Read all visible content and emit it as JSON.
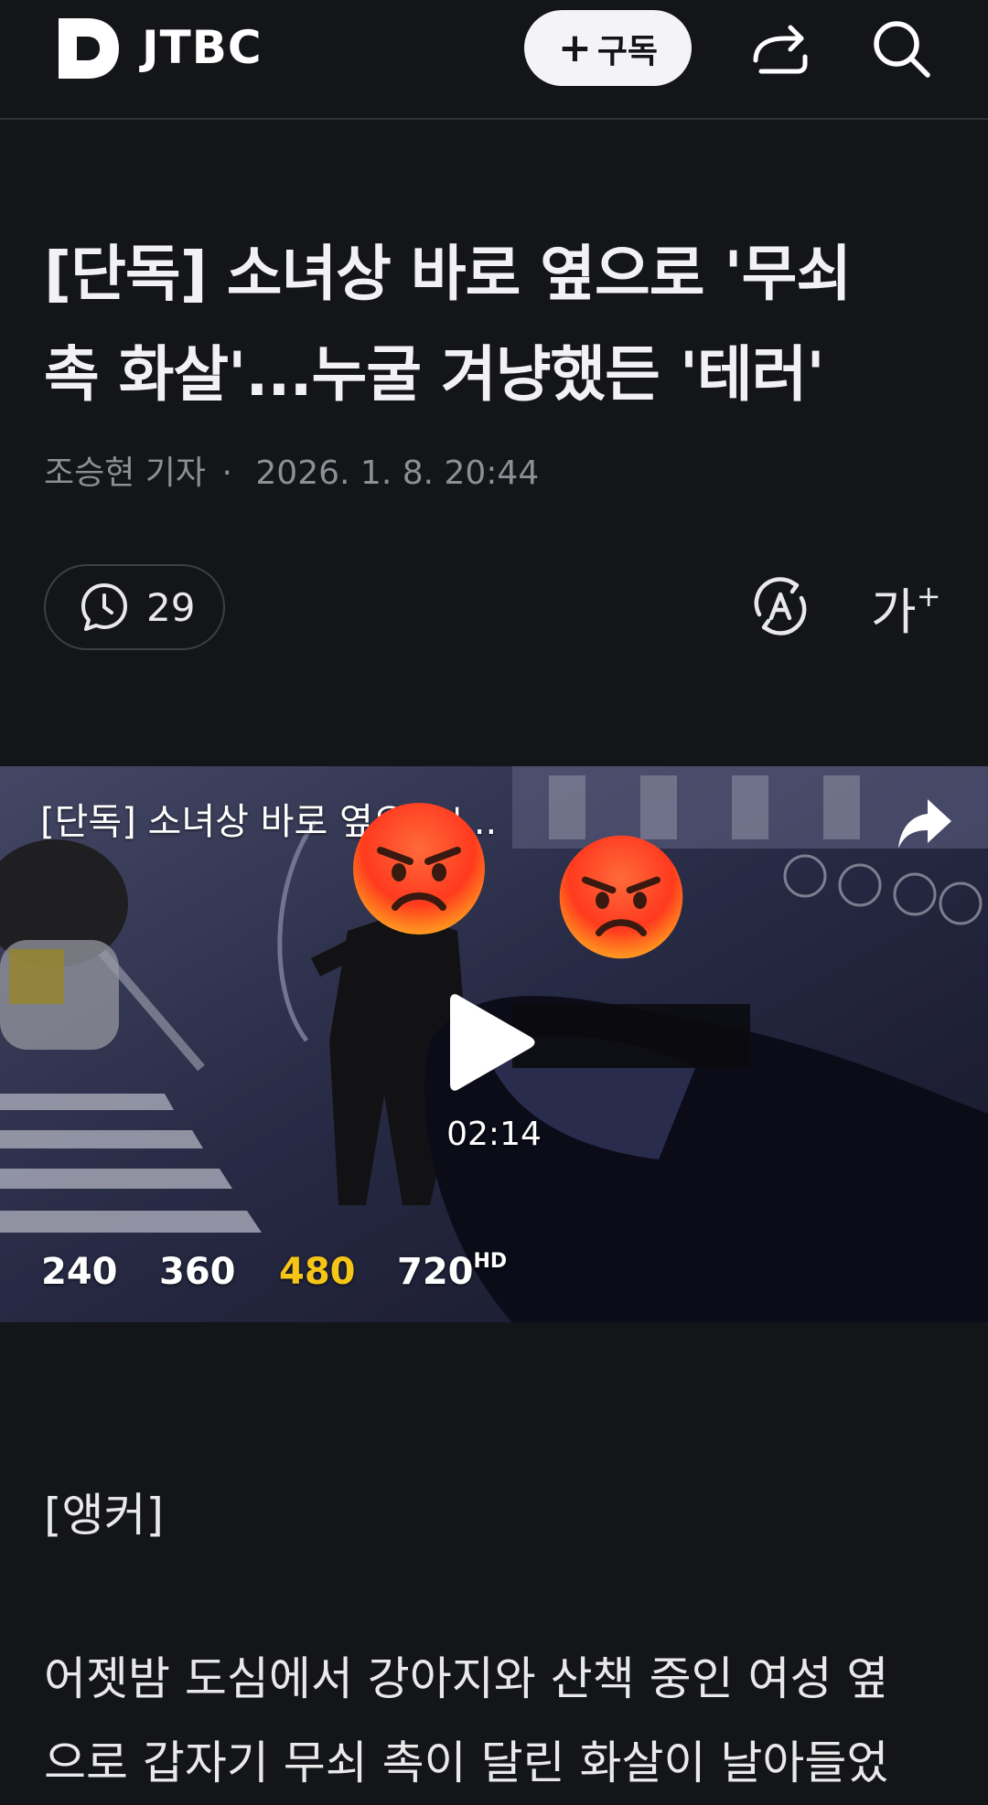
{
  "header": {
    "brand": "JTBC",
    "subscribe_label": "구독",
    "subscribe_plus": "+"
  },
  "article": {
    "title_line1": "[단독] 소녀상 바로 옆으로 '무쇠",
    "title_line2": "촉 화살'...누굴 겨냥했든 '테러'",
    "reporter": "조승현 기자",
    "separator": "·",
    "datetime": "2026. 1. 8. 20:44",
    "comment_count": "29",
    "font_size_label": "가",
    "font_size_plus": "+"
  },
  "video": {
    "title": "[단독] 소녀상 바로 옆으로 '...",
    "duration": "02:14",
    "qualities": [
      "240",
      "360",
      "480",
      "720"
    ],
    "hd_badge": "HD",
    "selected_quality": "480",
    "selected_color": "#f5c518"
  },
  "body": {
    "anchor_label": "[앵커]",
    "paragraph_line1": "어젯밤 도심에서 강아지와 산책 중인 여성 옆",
    "paragraph_line2": "으로 갑자기 무쇠 촉이 달린 화살이 날아들었"
  },
  "icons": {
    "logo": "daum-d-logo",
    "share": "share-icon",
    "search": "search-icon",
    "comment": "comment-icon",
    "translate": "translate-icon",
    "font_size": "font-size-icon",
    "play": "play-icon"
  },
  "colors": {
    "background": "#141518",
    "text": "#e9e9ea",
    "muted": "#8d8f95",
    "accent_quality": "#f5c518"
  }
}
